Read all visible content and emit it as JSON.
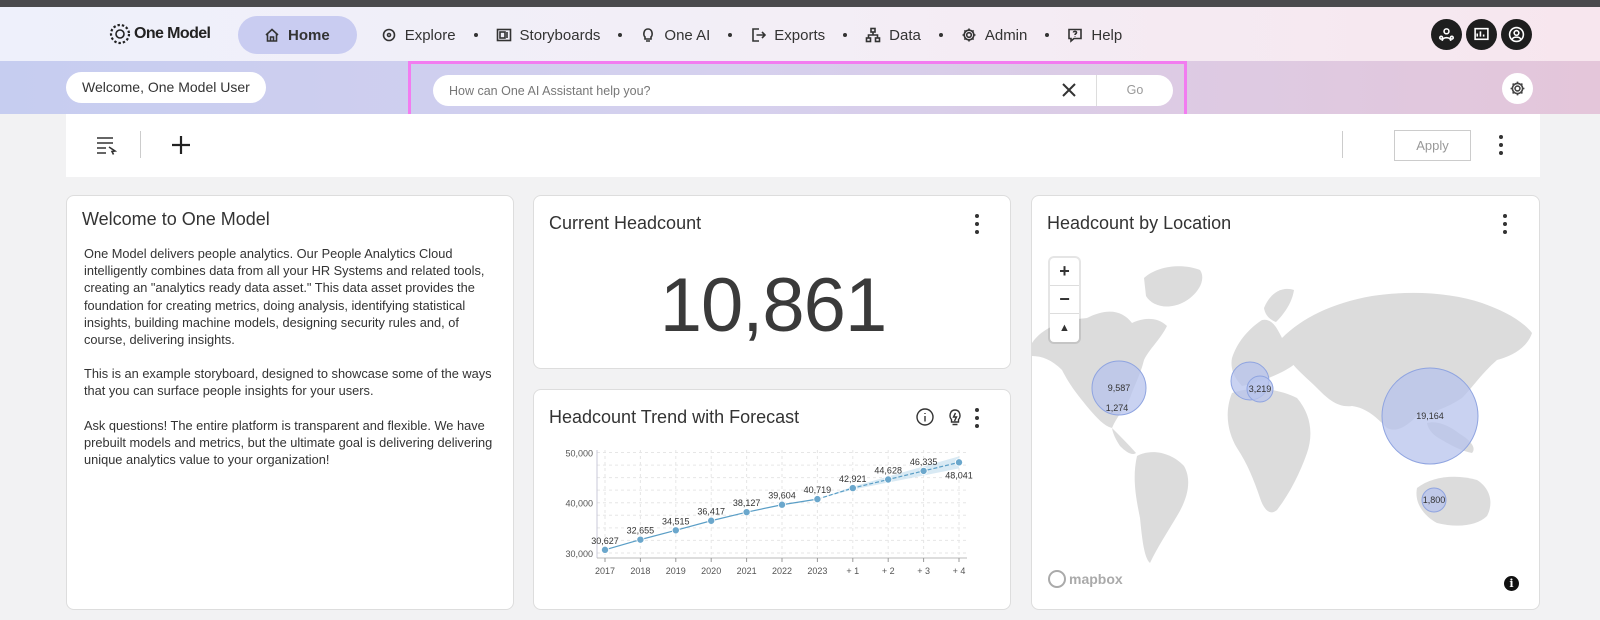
{
  "brand": {
    "logo_text": "One Model"
  },
  "nav": {
    "home": "Home",
    "explore": "Explore",
    "storyboards": "Storyboards",
    "one_ai": "One AI",
    "exports": "Exports",
    "data": "Data",
    "admin": "Admin",
    "help": "Help"
  },
  "assistant": {
    "welcome": "Welcome, One Model User",
    "placeholder": "How can One AI Assistant help you?",
    "go_label": "Go"
  },
  "toolbar": {
    "apply_label": "Apply"
  },
  "welcome_card": {
    "title": "Welcome to One Model",
    "paragraphs": [
      "One Model delivers people analytics. Our People Analytics Cloud intelligently combines data from all your HR Systems and related tools, creating an \"analytics ready data asset.\" This data asset provides the foundation for creating metrics, doing analysis, identifying statistical insights, building machine models, designing security rules and, of course, delivering insights.",
      "This is an example storyboard, designed to showcase some of the ways that you can surface people insights for your users.",
      "Ask questions! The entire platform is transparent and flexible. We have prebuilt models and metrics, but the ultimate goal is delivering delivering unique analytics value to your organization!"
    ]
  },
  "headcount_card": {
    "title": "Current Headcount",
    "value": "10,861"
  },
  "trend_card": {
    "title": "Headcount Trend with Forecast"
  },
  "map_card": {
    "title": "Headcount by Location",
    "attribution": "mapbox",
    "bubbles": [
      {
        "label": "9,587",
        "value": 9587
      },
      {
        "label": "1,274",
        "value": 1274
      },
      {
        "label": "3,219",
        "value": 3219
      },
      {
        "label": "19,164",
        "value": 19164
      },
      {
        "label": "1,800",
        "value": 1800
      }
    ]
  },
  "chart_data": {
    "type": "line",
    "title": "Headcount Trend with Forecast",
    "xlabel": "",
    "ylabel": "",
    "categories": [
      "2017",
      "2018",
      "2019",
      "2020",
      "2021",
      "2022",
      "2023",
      "+ 1",
      "+ 2",
      "+ 3",
      "+ 4"
    ],
    "series": [
      {
        "values": [
          30627,
          32655,
          34515,
          36417,
          38127,
          39604,
          40719,
          null,
          null,
          null,
          null
        ]
      },
      {
        "values": [
          null,
          null,
          null,
          null,
          null,
          null,
          40719,
          42921,
          44628,
          46335,
          48041
        ]
      }
    ],
    "data_labels": [
      "30,627",
      "32,655",
      "34,515",
      "36,417",
      "38,127",
      "39,604",
      "40,719",
      "42,921",
      "44,628",
      "46,335",
      "48,041"
    ],
    "yticks": [
      30000,
      40000,
      50000
    ],
    "ytick_labels": [
      "30,000",
      "40,000",
      "50,000"
    ],
    "ylim": [
      29000,
      50500
    ],
    "grid": true,
    "colors": {
      "line": "#5a9ec6",
      "marker": "#6ba7cc",
      "band": "#cfe5f1"
    }
  }
}
